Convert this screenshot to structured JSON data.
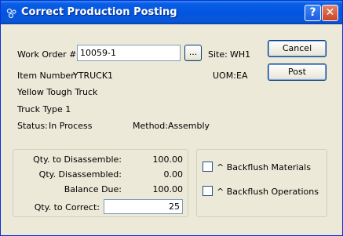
{
  "window": {
    "title": "Correct Production Posting",
    "help_glyph": "?",
    "close_glyph": "✕"
  },
  "form": {
    "work_order_label": "Work Order #:",
    "work_order_value": "10059-1",
    "browse_label": "...",
    "site_label": "Site:",
    "site_value": "WH1",
    "item_number_label": "Item Number:",
    "item_number_value": "YTRUCK1",
    "uom_label": "UOM:",
    "uom_value": "EA",
    "description1": "Yellow Tough Truck",
    "description2": "Truck Type 1",
    "status_label": "Status:",
    "status_value": "In Process",
    "method_label": "Method:",
    "method_value": "Assembly"
  },
  "buttons": {
    "cancel": "Cancel",
    "post": "Post"
  },
  "quantities": {
    "qty_to_disassemble_label": "Qty. to Disassemble:",
    "qty_to_disassemble_value": "100.00",
    "qty_disassembled_label": "Qty. Disassembled:",
    "qty_disassembled_value": "0.00",
    "balance_due_label": "Balance Due:",
    "balance_due_value": "100.00",
    "qty_to_correct_label": "Qty. to Correct:",
    "qty_to_correct_value": "25"
  },
  "options": {
    "backflush_materials": "^ Backflush Materials",
    "backflush_operations": "^ Backflush Operations",
    "backflush_materials_checked": false,
    "backflush_operations_checked": false
  },
  "icons": {
    "title": "gear-cluster-icon",
    "help": "help-icon",
    "close": "close-icon"
  }
}
